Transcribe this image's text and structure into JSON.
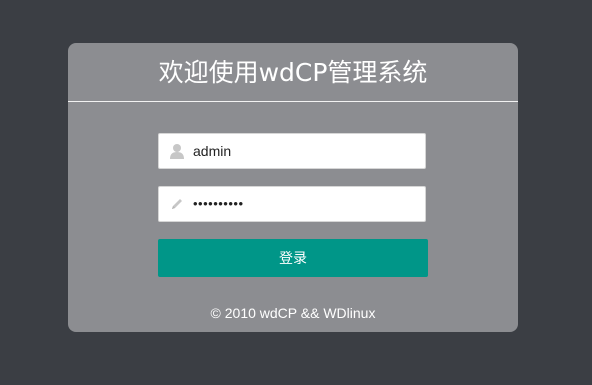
{
  "login": {
    "title": "欢迎使用wdCP管理系统",
    "username": {
      "value": "admin",
      "icon": "user-icon"
    },
    "password": {
      "value": "••••••••••",
      "icon": "pencil-icon"
    },
    "submit_label": "登录",
    "footer": "© 2010 wdCP && WDlinux"
  },
  "colors": {
    "page_background": "#3b3e44",
    "card_background": "#8c8d91",
    "button": "#009688",
    "text_on_card": "#ffffff"
  }
}
